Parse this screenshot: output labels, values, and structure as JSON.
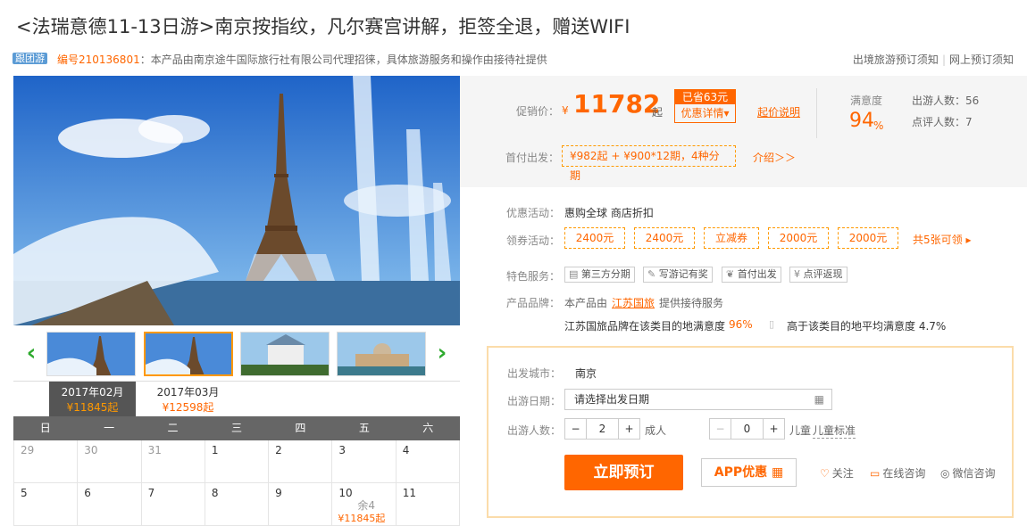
{
  "product": {
    "title": "<法瑞意德11-13日游>南京按指纹，凡尔赛宫讲解，拒签全退，赠送WIFI",
    "tag": "跟团游",
    "code_label": "编号210136801",
    "desc": "：本产品由南京途牛国际旅行社有限公司代理招徕，具体旅游服务和操作由接待社提供"
  },
  "toplinks": {
    "a": "出境旅游预订须知",
    "b": "网上预订须知"
  },
  "thumbnails": [
    "eiffel-fountain",
    "eiffel-fountain-selected",
    "neuschwanstein-castle",
    "venice-canal"
  ],
  "months": [
    {
      "label": "2017年02月",
      "price": "¥11845起"
    },
    {
      "label": "2017年03月",
      "price": "¥12598起"
    }
  ],
  "weekdays": [
    "日",
    "一",
    "二",
    "三",
    "四",
    "五",
    "六"
  ],
  "calendar": {
    "row1": [
      "29",
      "30",
      "31",
      "1",
      "2",
      "3",
      "4"
    ],
    "row2": [
      "5",
      "6",
      "7",
      "8",
      "9",
      "10",
      "11"
    ],
    "rest": "余4",
    "cell_price": "¥11845起"
  },
  "price": {
    "label": "促销价：",
    "currency": "¥",
    "value": "11782",
    "suffix": "起",
    "saved": "已省63元",
    "detail": "优惠详情▾",
    "explain": "起价说明",
    "first_label": "首付出发：",
    "first_plan": "¥982起 + ¥900*12期，4种分期",
    "intro": "介绍＞＞"
  },
  "stats": {
    "sat_label": "满意度",
    "sat_value": "94",
    "sat_unit": "%",
    "travelers": "出游人数：56",
    "reviews": "点评人数：7"
  },
  "promo": {
    "label": "优惠活动：",
    "text": "惠购全球 商店折扣"
  },
  "coupons": {
    "label": "领券活动：",
    "items": [
      "2400元",
      "2400元",
      "立减券",
      "2000元",
      "2000元"
    ],
    "more": "共5张可领 ▸"
  },
  "services": {
    "label": "特色服务：",
    "items": [
      "第三方分期",
      "写游记有奖",
      "首付出发",
      "点评返现"
    ]
  },
  "brand": {
    "label": "产品品牌：",
    "pre": "本产品由",
    "name": "江苏国旅",
    "post": "提供接待服务",
    "sat_text": "江苏国旅品牌在该类目的地满意度",
    "sat_val": "96%",
    "avg_text": "高于该类目的地平均满意度 4.7%"
  },
  "booking": {
    "city_label": "出发城市：",
    "city": "南京",
    "date_label": "出游日期：",
    "date_placeholder": "请选择出发日期",
    "people_label": "出游人数：",
    "adult_count": "2",
    "adult_label": "成人",
    "child_count": "0",
    "child_label": "儿童",
    "child_std": "儿童标准",
    "book_btn": "立即预订",
    "app_btn": "APP优惠",
    "follow": "关注",
    "online": "在线咨询",
    "wechat": "微信咨询"
  }
}
